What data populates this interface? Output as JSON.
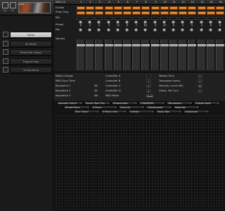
{
  "toolbar": {
    "items": [
      {
        "label": "ext",
        "icon": "expand-icon"
      },
      {
        "label": "rec",
        "icon": "record-icon"
      },
      {
        "label": "clr",
        "icon": "clear-icon"
      }
    ],
    "thumbnail_title": "Motif"
  },
  "sidebar": {
    "items": [
      {
        "label": "Home",
        "selected": true,
        "icon": "home-icon"
      },
      {
        "label": "All Voices",
        "selected": false,
        "icon": "voices-icon"
      },
      {
        "label": "Preset (Pan Room)",
        "selected": false,
        "icon": "preset-icon"
      },
      {
        "label": "Program Map",
        "selected": false,
        "icon": "map-icon"
      },
      {
        "label": "Tuning Setup",
        "selected": false,
        "icon": "tuning-icon"
      }
    ]
  },
  "mixer": {
    "midi_ch_label": "MIDI Ch",
    "channels": [
      "1",
      "2",
      "3",
      "4",
      "5",
      "6",
      "7",
      "8",
      "9",
      "10",
      "11",
      "12",
      "13",
      "14",
      "15",
      "16"
    ],
    "row_labels": {
      "enable": "Enable",
      "prog_chng": "Prog Chng",
      "mix": "Mix",
      "preset": "Preset",
      "pan": "Pan",
      "volume": "Volume"
    },
    "preset_values": [
      "6",
      "5",
      "4",
      "3",
      "12",
      "8",
      "7",
      "64",
      "9",
      "23",
      "6",
      "4",
      "9",
      "5",
      "6",
      "6"
    ],
    "accent_color": "#f08a2c"
  },
  "params": {
    "left": [
      {
        "label": "Mode Change"
      },
      {
        "label": "MIDI Sync Time"
      },
      {
        "label": "Keyswitch 1",
        "value": "64"
      },
      {
        "label": "Keyswitch 2",
        "value": "65"
      },
      {
        "label": "Keyswitch 3",
        "value": "66"
      }
    ],
    "mid": [
      {
        "label": "Controller A",
        "value": ""
      },
      {
        "label": "Controller B",
        "value": "1"
      },
      {
        "label": "Controller C",
        "value": "2"
      },
      {
        "label": "Controller D",
        "value": "4"
      },
      {
        "label": "MIDI Mode",
        "value": "Multi"
      }
    ],
    "right": [
      {
        "label": "Master Tune",
        "value": "0"
      },
      {
        "label": "Transpose (semi)",
        "value": "0"
      },
      {
        "label": "Velocity (curve Vel)",
        "value": "Hi"
      },
      {
        "label": "Glissa. Vel Curv",
        "value": "0"
      }
    ]
  },
  "presets": {
    "row1": [
      "Acoustic Grand",
      "Honky Tonk Pno",
      "Harpsichord",
      "STANDARD",
      "Vibraphone",
      "Tubular Bells"
    ],
    "row2": [
      "Bright Piano",
      "E.Piano",
      "Clavinet",
      "Glockenspiel",
      "Marimba"
    ],
    "row3": [
      "Elec Grand",
      "E.Piano Chrs",
      "Celesta",
      "Music Box",
      "Xylophone"
    ]
  }
}
